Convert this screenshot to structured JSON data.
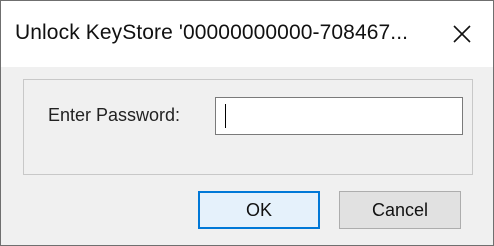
{
  "window": {
    "title": "Unlock KeyStore '00000000000-708467..."
  },
  "icons": {
    "close": "close-icon"
  },
  "form": {
    "password_label": "Enter Password:",
    "password_value": ""
  },
  "buttons": {
    "ok_label": "OK",
    "cancel_label": "Cancel"
  },
  "colors": {
    "accent": "#0078d7",
    "dialog_background": "#f0f0f0",
    "titlebar_background": "#ffffff"
  }
}
